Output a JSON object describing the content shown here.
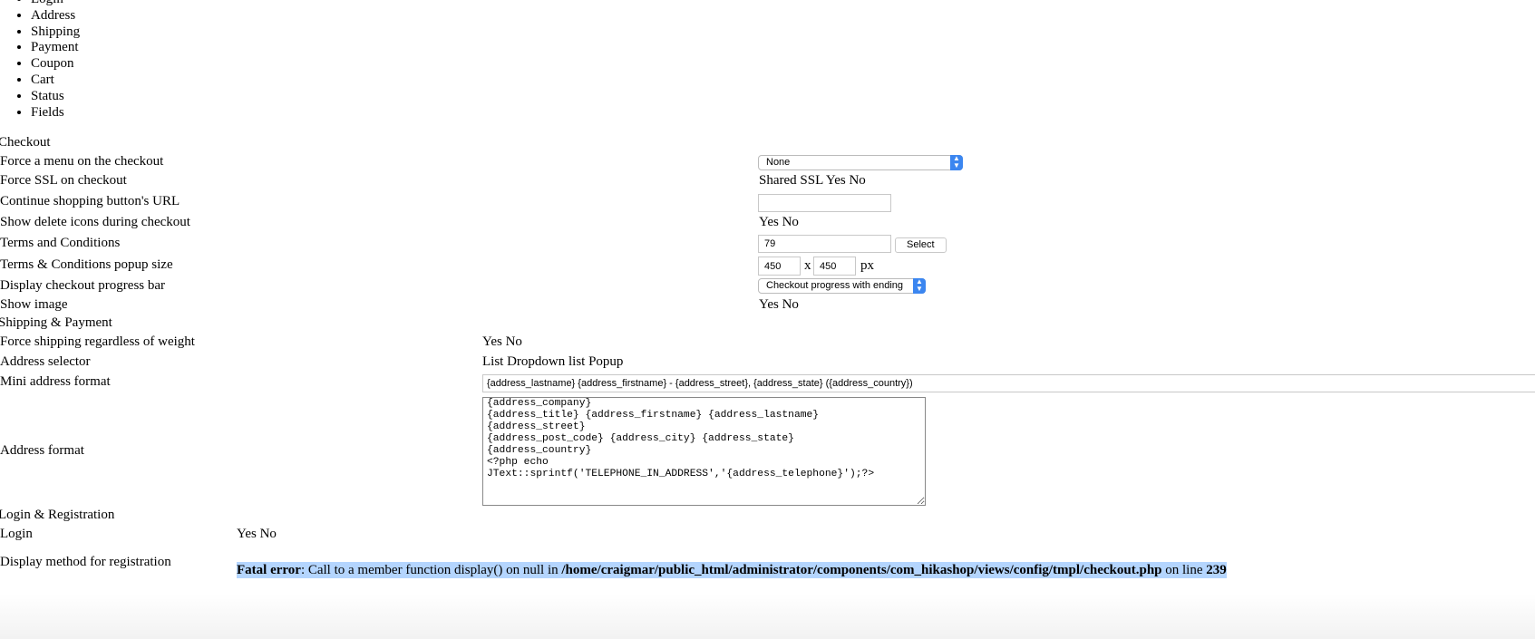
{
  "steps": [
    "Login",
    "Address",
    "Shipping",
    "Payment",
    "Coupon",
    "Cart",
    "Status",
    "Fields"
  ],
  "checkout": {
    "heading": "Checkout",
    "force_menu_label": "Force a menu on the checkout",
    "force_menu_value": "None",
    "force_ssl_label": "Force SSL on checkout",
    "force_ssl_options": "Shared SSL Yes No",
    "continue_url_label": "Continue shopping button's URL",
    "continue_url_value": "",
    "delete_icons_label": "Show delete icons during checkout",
    "delete_icons_options": "Yes No",
    "terms_label": "Terms and Conditions",
    "terms_value": "79",
    "terms_select": "Select",
    "popup_size_label": "Terms & Conditions popup size",
    "popup_width": "450",
    "popup_x": "x",
    "popup_height": "450",
    "popup_unit": "px",
    "progress_label": "Display checkout progress bar",
    "progress_value": "Checkout progress with ending",
    "show_image_label": "Show image",
    "show_image_options": "Yes No"
  },
  "shipping_payment": {
    "heading": "Shipping & Payment",
    "force_shipping_label": "Force shipping regardless of weight",
    "force_shipping_options": "Yes No",
    "address_selector_label": "Address selector",
    "address_selector_options": "List Dropdown list Popup",
    "mini_format_label": "Mini address format",
    "mini_format_value": "{address_lastname} {address_firstname} - {address_street}, {address_state} ({address_country})",
    "address_format_label": "Address format",
    "address_format_value": "{address_company}\n{address_title} {address_firstname} {address_lastname}\n{address_street}\n{address_post_code} {address_city} {address_state}\n{address_country}\n<?php echo\nJText::sprintf('TELEPHONE_IN_ADDRESS','{address_telephone}');?>"
  },
  "login_registration": {
    "heading": "Login & Registration",
    "login_label": "Login",
    "login_options": "Yes No",
    "display_method_label": "Display method for registration"
  },
  "error": {
    "prefix": "Fatal error",
    "message": ": Call to a member function display() on null in ",
    "path": "/home/craigmar/public_html/administrator/components/com_hikashop/views/config/tmpl/checkout.php",
    "on_line": " on line ",
    "line": "239"
  }
}
